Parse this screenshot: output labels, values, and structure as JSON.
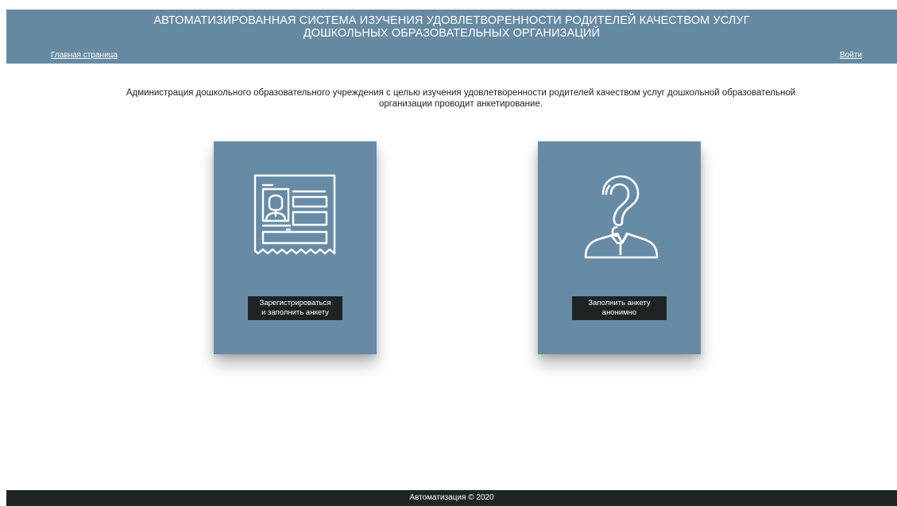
{
  "header": {
    "title_line1": "АВТОМАТИЗИРОВАННАЯ СИСТЕМА ИЗУЧЕНИЯ УДОВЛЕТВОРЕННОСТИ РОДИТЕЛЕЙ КАЧЕСТВОМ УСЛУГ",
    "title_line2": "ДОШКОЛЬНЫХ ОБРАЗОВАТЕЛЬНЫХ ОРГАНИЗАЦИЙ",
    "nav_home": "Главная страница",
    "nav_login": "Войти"
  },
  "intro": {
    "line1": "Администрация дошкольного образовательного учреждения с целью изучения удовлетворенности родителей качеством услуг дошкольной образовательной",
    "line2": "организации проводит анкетирование."
  },
  "cards": [
    {
      "icon": "id-card-icon",
      "button_line1": "Зарегистрироваться",
      "button_line2": "и заполнить анкету"
    },
    {
      "icon": "question-person-icon",
      "button_line1": "Заполнить анкету",
      "button_line2": "анонимно"
    }
  ],
  "footer": {
    "text": "Автоматизация © 2020"
  },
  "colors": {
    "header_bg": "#678aa3",
    "card_bg": "#688ba5",
    "button_bg": "#1e2426",
    "footer_bg": "#1f2527"
  }
}
